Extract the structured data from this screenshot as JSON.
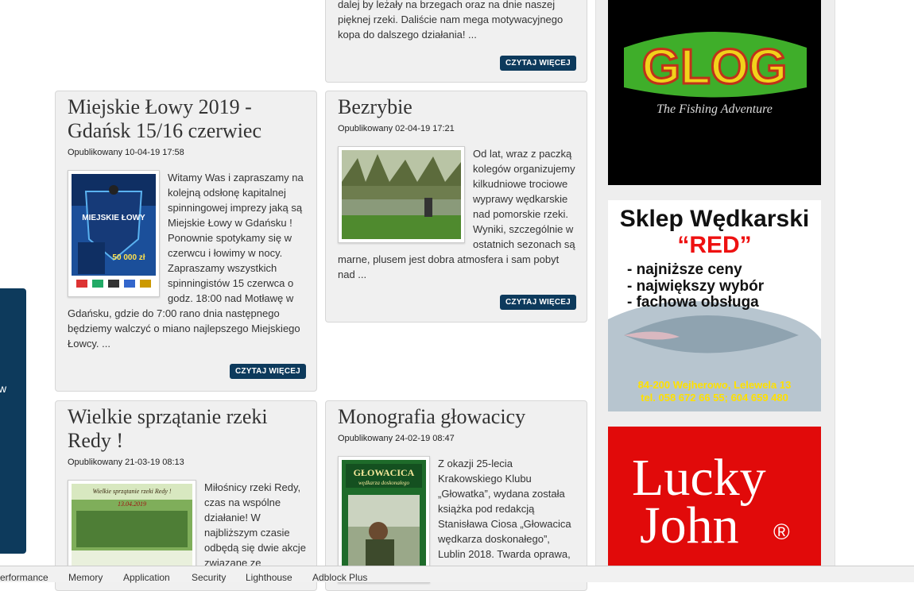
{
  "left_tab": {
    "label": "w"
  },
  "top_card": {
    "excerpt": "dalej by leżały na brzegach oraz na dnie naszej pięknej rzeki. Daliście nam mega motywacyjnego kopa do dalszego działania! ...",
    "button": "CZYTAJ WIĘCEJ"
  },
  "articles": [
    {
      "title": "Miejskie Łowy 2019 - Gdańsk 15/16 czerwiec",
      "meta": "Opublikowany 10-04-19 17:58",
      "excerpt": "Witamy Was i zapraszamy na kolejną odsłonę kapitalnej spinningowej imprezy jaką są Miejskie Łowy w Gdańsku ! Ponownie spotykamy się w czerwcu i łowimy w nocy. Zapraszamy wszystkich spinningistów 15 czerwca o godz. 18:00 nad Motławę w Gdańsku, gdzie do 7:00 rano dnia następnego będziemy walczyć o miano najlepszego Miejskiego Łowcy. ...",
      "button": "CZYTAJ WIĘCEJ",
      "poster_title": "MIEJSKIE ŁOWY",
      "poster_amount": "50 000 zł"
    },
    {
      "title": "Bezrybie",
      "meta": "Opublikowany 02-04-19 17:21",
      "excerpt": "Od lat, wraz z paczką kolegów organizujemy kilkudniowe trociowe wyprawy wędkarskie nad pomorskie rzeki. Wyniki, szczególnie w ostatnich sezonach są marne, plusem jest dobra atmosfera i sam pobyt nad ...",
      "button": "CZYTAJ WIĘCEJ"
    },
    {
      "title": "Wielkie sprzątanie rzeki Redy !",
      "meta": "Opublikowany 21-03-19 08:13",
      "excerpt": "Miłośnicy rzeki Redy, czas na wspólne działanie! W najbliższym czasie odbędą się dwie akcje związane ze",
      "poster_title": "Wielkie sprzątanie rzeki Redy !",
      "poster_date": "13.04.2019"
    },
    {
      "title": "Monografia głowacicy",
      "meta": "Opublikowany 24-02-19 08:47",
      "excerpt": "Z okazji 25-lecia Krakowskiego Klubu „Głowatka”, wydana została książka pod redakcją Stanisława Ciosa „Głowacica wędkarza doskonałego”, Lublin 2018. Twarda oprawa,",
      "book_title": "GŁOWACICA",
      "book_subtitle": "wędkarza doskonałego"
    }
  ],
  "ads": {
    "glog": {
      "brand": "GLOG",
      "tagline": "The Fishing Adventure"
    },
    "red": {
      "title": "Sklep Wędkarski",
      "name": "“RED”",
      "bullets": [
        "- najniższe ceny",
        "- największy wybór",
        "- fachowa obsługa"
      ],
      "address": "84-200 Wejherowo, Lelewela 13",
      "phone": "tel. 058 672 66 55; 604 659 480"
    },
    "lucky": {
      "line1": "Lucky",
      "line2": "John",
      "mark": "®"
    }
  },
  "devtools_tabs": [
    "erformance",
    "Memory",
    "Application",
    "Security",
    "Lighthouse",
    "Adblock Plus"
  ],
  "colors": {
    "button": "#0d3a5c",
    "glog_bg": "#000000",
    "lucky_bg": "#e10a0a"
  }
}
